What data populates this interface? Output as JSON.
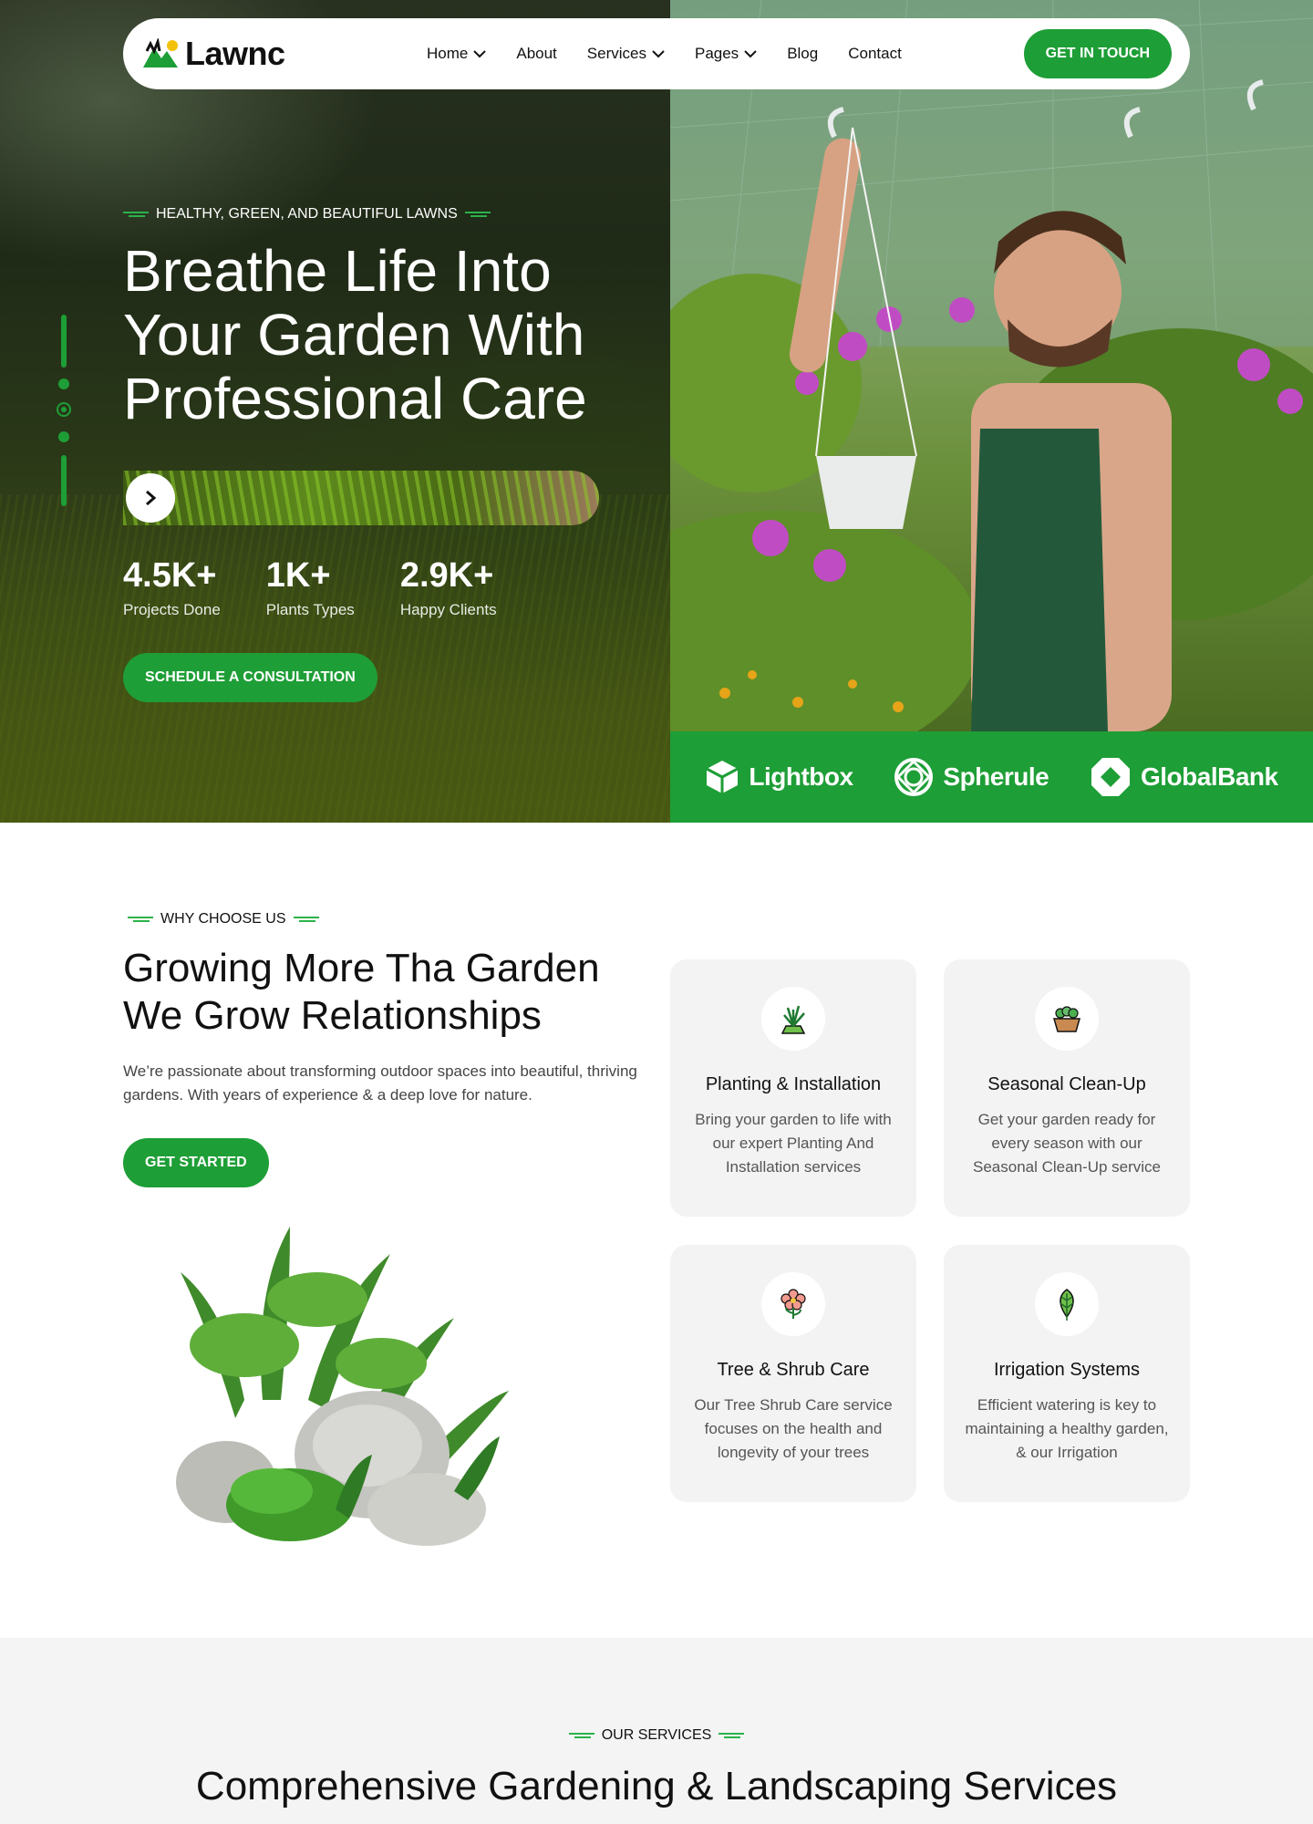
{
  "brand": {
    "name": "Lawnc"
  },
  "nav": {
    "items": [
      {
        "label": "Home",
        "dropdown": true
      },
      {
        "label": "About",
        "dropdown": false
      },
      {
        "label": "Services",
        "dropdown": true
      },
      {
        "label": "Pages",
        "dropdown": true
      },
      {
        "label": "Blog",
        "dropdown": false
      },
      {
        "label": "Contact",
        "dropdown": false
      }
    ],
    "cta": "GET IN TOUCH"
  },
  "hero": {
    "eyebrow": "HEALTHY, GREEN, AND BEAUTIFUL LAWNS",
    "title": "Breathe Life Into Your Garden With Professional Care",
    "stats": [
      {
        "value": "4.5K+",
        "label": "Projects Done"
      },
      {
        "value": "1K+",
        "label": "Plants Types"
      },
      {
        "value": "2.9K+",
        "label": "Happy Clients"
      }
    ],
    "cta": "SCHEDULE A CONSULTATION",
    "partners": [
      "Lightbox",
      "Spherule",
      "GlobalBank"
    ]
  },
  "why": {
    "eyebrow": "WHY CHOOSE US",
    "title": "Growing More Tha Garden We Grow Relationships",
    "description": "We’re passionate about transforming outdoor spaces into beautiful, thriving gardens. With years of experience & a deep love for nature.",
    "cta": "GET STARTED",
    "cards": [
      {
        "title": "Planting & Installation",
        "description": "Bring your garden to life with our expert Planting And Installation services",
        "icon": "plant-icon"
      },
      {
        "title": "Seasonal Clean-Up",
        "description": "Get your garden ready for every season with our Seasonal Clean-Up service",
        "icon": "planter-box-icon"
      },
      {
        "title": "Tree & Shrub Care",
        "description": "Our Tree Shrub Care service focuses on the health and longevity of your trees",
        "icon": "flower-icon"
      },
      {
        "title": "Irrigation Systems",
        "description": "Efficient watering is key to maintaining a healthy garden, & our Irrigation",
        "icon": "leaf-icon"
      }
    ]
  },
  "services": {
    "eyebrow": "OUR SERVICES",
    "title": "Comprehensive Gardening & Landscaping Services"
  },
  "colors": {
    "accent": "#1e9e36",
    "dark": "#111111",
    "card_bg": "#f3f3f3",
    "section_bg": "#f4f4f4"
  }
}
